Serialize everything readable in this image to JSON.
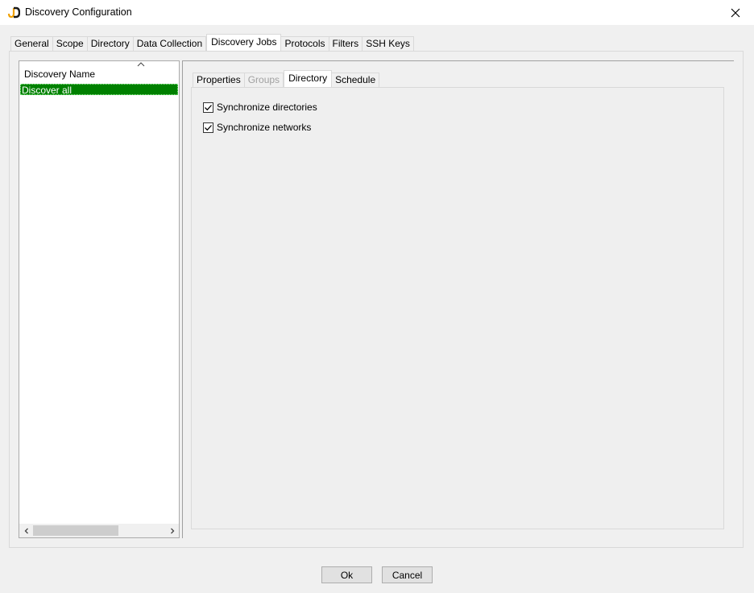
{
  "window": {
    "title": "Discovery Configuration",
    "icon": "jd-logo-icon",
    "close_icon": "close-icon"
  },
  "main_tabs": [
    {
      "label": "General",
      "active": false
    },
    {
      "label": "Scope",
      "active": false
    },
    {
      "label": "Directory",
      "active": false
    },
    {
      "label": "Data Collection",
      "active": false
    },
    {
      "label": "Discovery Jobs",
      "active": true
    },
    {
      "label": "Protocols",
      "active": false
    },
    {
      "label": "Filters",
      "active": false
    },
    {
      "label": "SSH Keys",
      "active": false
    }
  ],
  "jobs_list": {
    "header": "Discovery Name",
    "rows": [
      "Discover all"
    ],
    "selected_color": "#008000"
  },
  "sub_tabs": [
    {
      "label": "Properties",
      "state": "normal"
    },
    {
      "label": "Groups",
      "state": "disabled"
    },
    {
      "label": "Directory",
      "state": "active"
    },
    {
      "label": "Schedule",
      "state": "normal"
    }
  ],
  "directory_options": [
    {
      "label": "Synchronize directories",
      "checked": true
    },
    {
      "label": "Synchronize networks",
      "checked": true
    }
  ],
  "buttons": {
    "ok": "Ok",
    "cancel": "Cancel"
  }
}
